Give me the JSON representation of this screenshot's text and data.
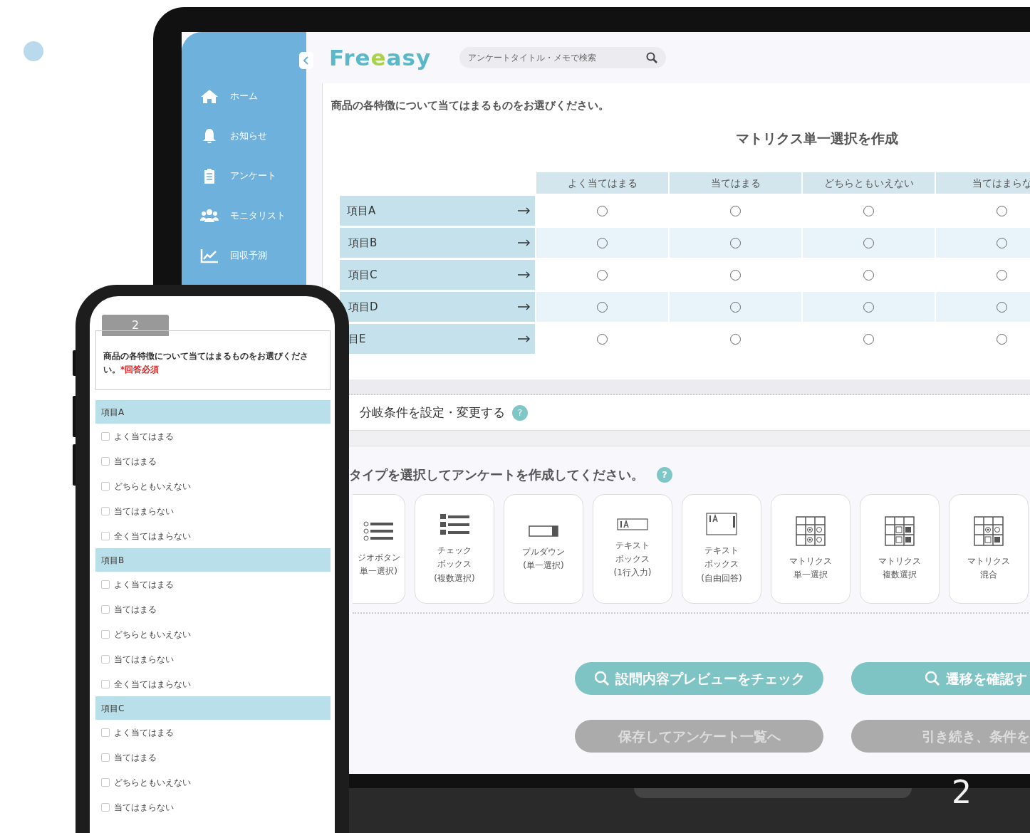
{
  "sidebar": {
    "items": [
      {
        "label": "ホーム",
        "kind": "home"
      },
      {
        "label": "お知らせ",
        "kind": "bell"
      },
      {
        "label": "アンケート",
        "kind": "clipboard"
      },
      {
        "label": "モニタリスト",
        "kind": "users"
      },
      {
        "label": "回収予測",
        "kind": "chart"
      }
    ]
  },
  "header": {
    "logo": [
      {
        "text": "Fre",
        "color": "#5bb8c8"
      },
      {
        "text": "e",
        "color": "#a9d24a"
      },
      {
        "text": "asy",
        "color": "#5bb8c8"
      }
    ],
    "search": {
      "placeholder": "アンケートタイトル・メモで検索"
    }
  },
  "question": "商品の各特徴について当てはまるものをお選びください。",
  "title": "マトリクス単一選択を作成",
  "matrix": {
    "columns": [
      "よく当てはまる",
      "当てはまる",
      "どちらともいえない",
      "当てはまらな"
    ],
    "rows": [
      {
        "label": "項目A",
        "cells": [
          {
            "selected": false
          },
          {
            "selected": false
          },
          {
            "selected": false
          },
          {
            "selected": false
          }
        ]
      },
      {
        "label": "項目B",
        "cells": [
          {
            "selected": false
          },
          {
            "selected": false
          },
          {
            "selected": false
          },
          {
            "selected": false
          }
        ]
      },
      {
        "label": "項目C",
        "cells": [
          {
            "selected": false
          },
          {
            "selected": false
          },
          {
            "selected": false
          },
          {
            "selected": false
          }
        ]
      },
      {
        "label": "項目D",
        "cells": [
          {
            "selected": false
          },
          {
            "selected": false
          },
          {
            "selected": false
          },
          {
            "selected": false
          }
        ]
      },
      {
        "label": "目E",
        "cells": [
          {
            "selected": false
          },
          {
            "selected": false
          },
          {
            "selected": false
          },
          {
            "selected": false
          }
        ]
      }
    ]
  },
  "branch": {
    "label": "分岐条件を設定・変更する",
    "help": "?"
  },
  "types": {
    "prompt": "タイプを選択してアンケートを作成してください。",
    "help": "?",
    "items": [
      {
        "kind": "radio",
        "lines": [
          "ジオボタン",
          "単一選択)"
        ]
      },
      {
        "kind": "checkbox",
        "lines": [
          "チェック",
          "ボックス",
          "(複数選択)"
        ]
      },
      {
        "kind": "dropdown",
        "lines": [
          "プルダウン",
          "(単一選択)"
        ]
      },
      {
        "kind": "textline",
        "lines": [
          "テキスト",
          "ボックス",
          "(1行入力)"
        ]
      },
      {
        "kind": "textarea",
        "lines": [
          "テキスト",
          "ボックス",
          "(自由回答)"
        ]
      },
      {
        "kind": "matrix-single",
        "lines": [
          "マトリクス",
          "単一選択"
        ]
      },
      {
        "kind": "matrix-multi",
        "lines": [
          "マトリクス",
          "複数選択"
        ]
      },
      {
        "kind": "matrix-mixed",
        "lines": [
          "マトリクス",
          "混合"
        ]
      }
    ]
  },
  "buttons": [
    {
      "label": "設問内容プレビューをチェック",
      "kind": "primary"
    },
    {
      "label": "遷移を確認す",
      "kind": "primary"
    },
    {
      "label": "保存してアンケート一覧へ",
      "kind": "secondary"
    },
    {
      "label": "引き続き、条件を",
      "kind": "secondary"
    }
  ],
  "phone": {
    "number": "2",
    "question": "商品の各特徴について当てはまるものをお選びください。",
    "required": "*回答必須",
    "items": [
      {
        "label": "項目A",
        "options": [
          {
            "label": "よく当てはまる",
            "checked": false
          },
          {
            "label": "当てはまる",
            "checked": false
          },
          {
            "label": "どちらともいえない",
            "checked": false
          },
          {
            "label": "当てはまらない",
            "checked": false
          },
          {
            "label": "全く当てはまらない",
            "checked": false
          }
        ]
      },
      {
        "label": "項目B",
        "options": [
          {
            "label": "よく当てはまる",
            "checked": false
          },
          {
            "label": "当てはまる",
            "checked": false
          },
          {
            "label": "どちらともいえない",
            "checked": false
          },
          {
            "label": "当てはまらない",
            "checked": false
          },
          {
            "label": "全く当てはまらない",
            "checked": false
          }
        ]
      },
      {
        "label": "項目C",
        "options": [
          {
            "label": "よく当てはまる",
            "checked": false
          },
          {
            "label": "当てはまる",
            "checked": false
          },
          {
            "label": "どちらともいえない",
            "checked": false
          },
          {
            "label": "当てはまらない",
            "checked": false
          }
        ]
      }
    ]
  },
  "slide_number": "2"
}
